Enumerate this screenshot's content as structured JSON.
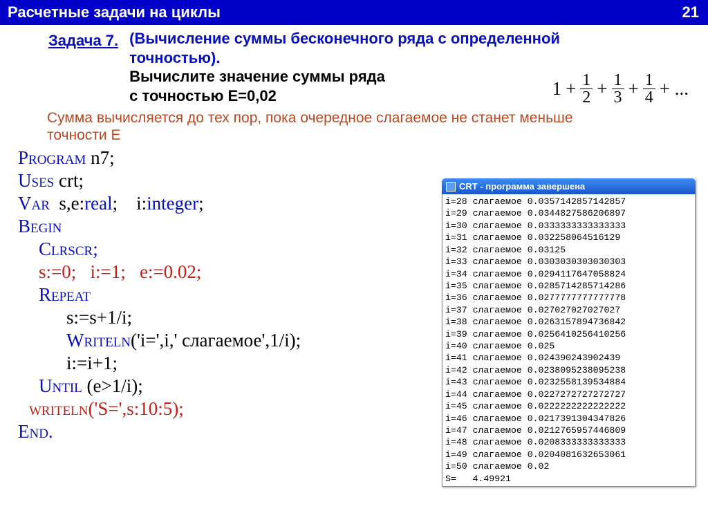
{
  "header": {
    "title": "Расчетные задачи на циклы",
    "page": "21"
  },
  "task": {
    "label": "Задача 7.",
    "desc1a": "(Вычисление суммы бесконечного ряда с определенной",
    "desc1b": "точностью).",
    "desc2a": "Вычислите значение суммы ряда",
    "desc2b": "с точностью E=0,02"
  },
  "formula": {
    "lead": "1",
    "plus": "+",
    "f1n": "1",
    "f1d": "2",
    "f2n": "1",
    "f2d": "3",
    "f3n": "1",
    "f3d": "4",
    "tail": "+ ..."
  },
  "note": {
    "l1": "Сумма вычисляется до тех пор, пока очередное слагаемое не станет меньше",
    "l2": "точности E"
  },
  "code": {
    "l1a": "Program",
    "l1b": " n7;",
    "l2a": "Uses",
    "l2b": " crt;",
    "l3a": "Var",
    "l3b": "  s,e:",
    "l3c": "real",
    "l3d": ";    i:",
    "l3e": "integer",
    "l3f": ";",
    "l4": "Begin",
    "l5": "Clrscr;",
    "l6": "s:=0;   i:=1;   e:=0.02;",
    "l7": "Repeat",
    "l8": "s:=s+1/i;",
    "l9a": "Writeln",
    "l9b": "('i=',i,' слагаемое',1/i);",
    "l10": "i:=i+1;",
    "l11a": "Until",
    "l11b": " (e>1/i);",
    "l12a": "writeln",
    "l12b": "('S=',s:10:5);",
    "l13": "End."
  },
  "crt": {
    "title": "CRT - программа завершена",
    "rows": [
      "i=28 слагаемое 0.0357142857142857",
      "i=29 слагаемое 0.0344827586206897",
      "i=30 слагаемое 0.0333333333333333",
      "i=31 слагаемое 0.032258064516129",
      "i=32 слагаемое 0.03125",
      "i=33 слагаемое 0.0303030303030303",
      "i=34 слагаемое 0.0294117647058824",
      "i=35 слагаемое 0.0285714285714286",
      "i=36 слагаемое 0.0277777777777778",
      "i=37 слагаемое 0.027027027027027",
      "i=38 слагаемое 0.0263157894736842",
      "i=39 слагаемое 0.0256410256410256",
      "i=40 слагаемое 0.025",
      "i=41 слагаемое 0.024390243902439",
      "i=42 слагаемое 0.0238095238095238",
      "i=43 слагаемое 0.0232558139534884",
      "i=44 слагаемое 0.0227272727272727",
      "i=45 слагаемое 0.0222222222222222",
      "i=46 слагаемое 0.0217391304347826",
      "i=47 слагаемое 0.0212765957446809",
      "i=48 слагаемое 0.0208333333333333",
      "i=49 слагаемое 0.0204081632653061",
      "i=50 слагаемое 0.02",
      "S=   4.49921"
    ]
  }
}
